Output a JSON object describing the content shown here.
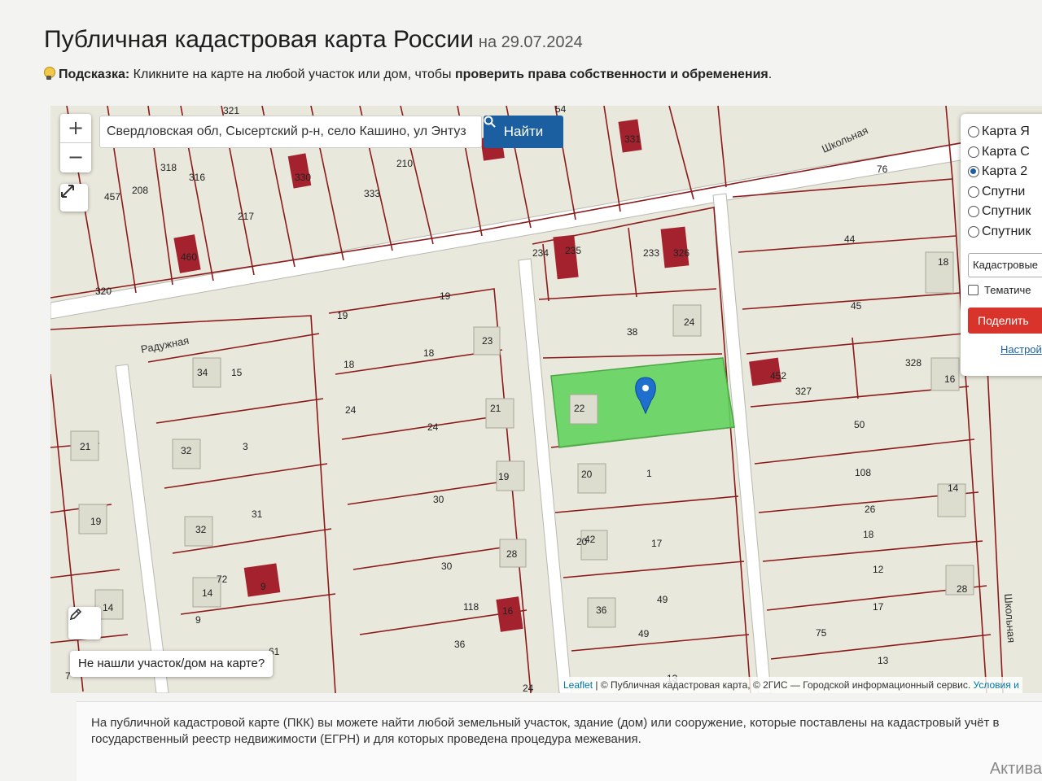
{
  "header": {
    "title": "Публичная кадастровая карта России",
    "date": "на 29.07.2024",
    "hint_label": "Подсказка:",
    "hint_text": "Кликните на карте на любой участок или дом, чтобы",
    "hint_bold": "проверить права собственности и обременения",
    "hint_end": "."
  },
  "map": {
    "zoom_in": "+",
    "zoom_out": "−",
    "search_value": "Свердловская обл, Сысертский р-н, село Кашино, ул Энтуз",
    "search_button": "Найти",
    "layers": [
      {
        "label": "Карта Я",
        "selected": false
      },
      {
        "label": "Карта С",
        "selected": false
      },
      {
        "label": "Карта 2",
        "selected": true
      },
      {
        "label": "Спутни",
        "selected": false
      },
      {
        "label": "Спутник",
        "selected": false
      },
      {
        "label": "Спутник",
        "selected": false
      }
    ],
    "layer_select": "Кадастровые",
    "thematic_label": "Тематиче",
    "share_button": "Поделить",
    "settings_link": "Настрой",
    "not_found_button": "Не нашли участок/дом на карте?",
    "attribution": {
      "leaflet": "Leaflet",
      "sep": " | ",
      "copy1": "© Публичная кадастровая карта",
      "copy2": ", © 2ГИС — Городской информационный сервис",
      "terms": "Условия и"
    },
    "street_labels": [
      "Радужная",
      "Школьная",
      "Школьная"
    ],
    "parcel_numbers": [
      "321",
      "54",
      "457",
      "208",
      "318",
      "316",
      "330",
      "333",
      "210",
      "217",
      "331",
      "76",
      "460",
      "320",
      "234",
      "235",
      "233",
      "326",
      "44",
      "18",
      "19",
      "19",
      "45",
      "38",
      "24",
      "23",
      "18",
      "34",
      "15",
      "18",
      "24",
      "21",
      "22",
      "452",
      "327",
      "328",
      "16",
      "21",
      "32",
      "3",
      "24",
      "50",
      "20",
      "1",
      "19",
      "108",
      "20",
      "14",
      "19",
      "30",
      "26",
      "32",
      "31",
      "18",
      "42",
      "17",
      "28",
      "30",
      "12",
      "28",
      "14",
      "72",
      "9",
      "118",
      "16",
      "36",
      "49",
      "17",
      "14",
      "9",
      "36",
      "49",
      "75",
      "13",
      "61",
      "13",
      "24",
      "7"
    ],
    "marker": "location-pin",
    "selected_parcel_color": "#6fd36a"
  },
  "info": {
    "text": "На публичной кадастровой карте (ПКК) вы можете найти любой земельный участок, здание (дом) или сооружение, которые поставлены на кадастровый учёт в государственный реестр недвижимости (ЕГРН) и для которых проведена процедура межевания."
  },
  "os_watermark": "Актива"
}
